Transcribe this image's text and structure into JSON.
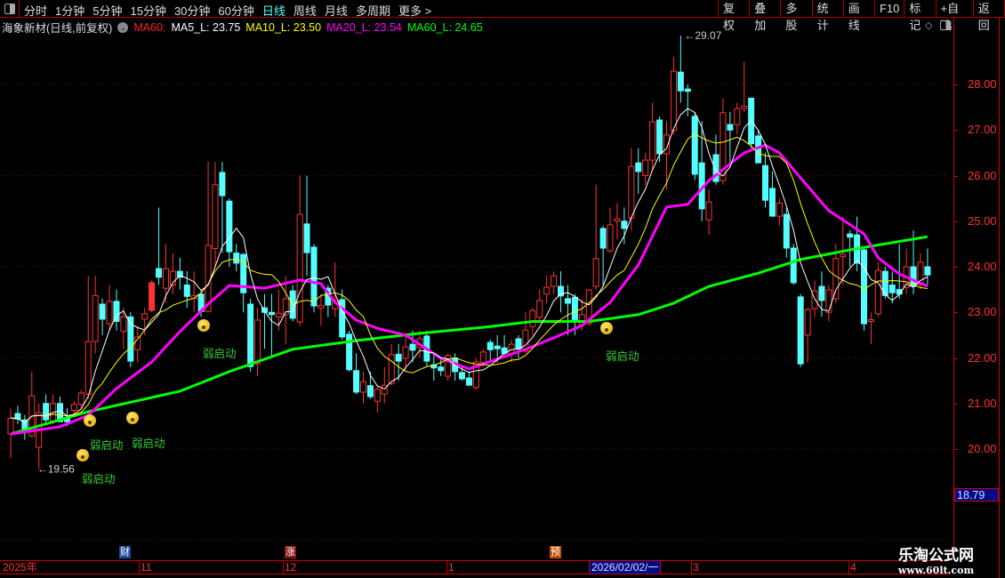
{
  "toolbar": {
    "periods": [
      "分时",
      "1分钟",
      "5分钟",
      "15分钟",
      "30分钟",
      "60分钟",
      "日线",
      "周线",
      "月线",
      "多周期",
      "更多 >"
    ],
    "active_period": "日线",
    "right_buttons": [
      "复权",
      "叠加",
      "多股",
      "统计",
      "画线",
      "F10",
      "标记",
      "+自选",
      "返回"
    ]
  },
  "title": {
    "stock": "海象新材(日线,前复权)",
    "ma_name": "MA60:",
    "ma5": "MA5_L: 23.75",
    "ma10": "MA10_L: 23.50",
    "ma20": "MA20_L: 23.54",
    "ma60": "MA60_L: 24.65"
  },
  "colors": {
    "up": "#ff3232",
    "down": "#54ffff",
    "ma5": "#ffffff",
    "ma10": "#ffff00",
    "ma20": "#ff00ff",
    "ma60": "#00ff00",
    "grid": "#a00000"
  },
  "price_axis": {
    "labels": [
      "28.00",
      "27.00",
      "26.00",
      "25.00",
      "24.00",
      "23.00",
      "22.00",
      "21.00",
      "20.00"
    ],
    "current": "18.79"
  },
  "chart_data": {
    "type": "candlestick",
    "ylim": [
      18.79,
      29.3
    ],
    "high_label": "29.07",
    "low_label": "19.56",
    "candles": [
      [
        20.33,
        20.9,
        19.8,
        20.68
      ],
      [
        20.78,
        20.95,
        20.55,
        20.66
      ],
      [
        20.64,
        20.75,
        20.2,
        20.39
      ],
      [
        20.29,
        21.7,
        20.25,
        21.17
      ],
      [
        20.04,
        21.0,
        19.56,
        20.8
      ],
      [
        21.0,
        21.2,
        20.55,
        20.64
      ],
      [
        20.62,
        21.2,
        20.55,
        21.0
      ],
      [
        21.0,
        21.15,
        20.6,
        20.6
      ],
      [
        20.68,
        20.9,
        20.5,
        20.6
      ],
      [
        20.85,
        21.05,
        20.7,
        20.98
      ],
      [
        20.98,
        21.3,
        20.9,
        21.23
      ],
      [
        21.2,
        23.8,
        21.1,
        22.36
      ],
      [
        22.36,
        23.8,
        22.1,
        23.37
      ],
      [
        23.18,
        23.3,
        22.5,
        22.85
      ],
      [
        22.75,
        23.6,
        22.6,
        23.24
      ],
      [
        23.24,
        23.5,
        22.6,
        22.8
      ],
      [
        22.58,
        23.1,
        22.2,
        22.9
      ],
      [
        22.9,
        23.0,
        21.8,
        21.93
      ],
      [
        22.18,
        22.7,
        21.9,
        22.46
      ],
      [
        22.85,
        23.1,
        22.5,
        22.97
      ],
      [
        23.04,
        23.7,
        23.0,
        23.65
      ],
      [
        23.96,
        25.3,
        23.6,
        23.77
      ],
      [
        23.53,
        24.5,
        23.2,
        23.96
      ],
      [
        23.6,
        24.3,
        23.4,
        23.9
      ],
      [
        23.9,
        24.2,
        23.5,
        23.77
      ],
      [
        23.6,
        23.9,
        23.1,
        23.35
      ],
      [
        23.3,
        23.9,
        23.0,
        23.37
      ],
      [
        23.4,
        23.5,
        22.9,
        23.02
      ],
      [
        23.02,
        26.3,
        23.0,
        24.47
      ],
      [
        24.4,
        26.3,
        24.0,
        25.8
      ],
      [
        26.07,
        26.3,
        24.3,
        25.56
      ],
      [
        25.44,
        25.5,
        24.0,
        24.33
      ],
      [
        24.3,
        24.5,
        23.9,
        24.08
      ],
      [
        24.27,
        24.3,
        23.0,
        23.43
      ],
      [
        23.18,
        23.3,
        21.7,
        21.81
      ],
      [
        21.87,
        23.1,
        21.6,
        22.83
      ],
      [
        23.1,
        23.4,
        22.2,
        23.0
      ],
      [
        23.0,
        23.4,
        22.0,
        22.95
      ],
      [
        22.9,
        23.5,
        22.6,
        22.98
      ],
      [
        22.95,
        23.8,
        22.3,
        23.3
      ],
      [
        23.47,
        23.6,
        22.8,
        22.87
      ],
      [
        22.79,
        26.0,
        22.7,
        25.15
      ],
      [
        24.94,
        26.0,
        23.8,
        24.31
      ],
      [
        24.43,
        24.5,
        23.0,
        23.14
      ],
      [
        23.1,
        23.4,
        22.7,
        23.15
      ],
      [
        23.53,
        23.6,
        22.9,
        23.16
      ],
      [
        23.08,
        24.1,
        22.9,
        23.26
      ],
      [
        23.28,
        23.5,
        22.4,
        22.46
      ],
      [
        22.52,
        22.6,
        21.7,
        21.74
      ],
      [
        21.72,
        22.1,
        21.2,
        21.25
      ],
      [
        21.25,
        21.7,
        21.0,
        21.48
      ],
      [
        21.39,
        21.7,
        21.1,
        21.15
      ],
      [
        21.05,
        21.4,
        20.8,
        21.31
      ],
      [
        21.21,
        21.8,
        21.0,
        21.4
      ],
      [
        21.44,
        22.3,
        21.4,
        22.07
      ],
      [
        22.08,
        22.3,
        21.5,
        21.93
      ],
      [
        21.99,
        22.5,
        21.7,
        22.24
      ],
      [
        22.3,
        22.6,
        21.9,
        22.17
      ],
      [
        22.22,
        22.6,
        22.0,
        22.42
      ],
      [
        22.48,
        22.6,
        21.8,
        21.93
      ],
      [
        21.85,
        22.1,
        21.5,
        21.78
      ],
      [
        21.8,
        22.0,
        21.6,
        21.72
      ],
      [
        21.6,
        22.1,
        21.5,
        22.05
      ],
      [
        22.0,
        22.1,
        21.5,
        21.7
      ],
      [
        21.68,
        21.8,
        21.5,
        21.54
      ],
      [
        21.56,
        21.7,
        21.4,
        21.4
      ],
      [
        21.35,
        22.0,
        21.3,
        21.91
      ],
      [
        21.9,
        22.2,
        21.8,
        22.13
      ],
      [
        22.34,
        22.4,
        21.9,
        22.18
      ],
      [
        22.26,
        22.5,
        21.9,
        22.2
      ],
      [
        22.22,
        22.5,
        22.0,
        22.1
      ],
      [
        22.09,
        22.4,
        21.9,
        22.3
      ],
      [
        22.42,
        22.5,
        22.0,
        22.2
      ],
      [
        22.15,
        23.0,
        22.1,
        22.61
      ],
      [
        22.69,
        23.1,
        22.5,
        23.04
      ],
      [
        22.89,
        23.5,
        22.8,
        23.26
      ],
      [
        23.4,
        23.8,
        23.2,
        23.55
      ],
      [
        23.57,
        23.9,
        23.4,
        23.8
      ],
      [
        23.57,
        23.9,
        23.0,
        23.36
      ],
      [
        23.3,
        23.6,
        22.5,
        23.2
      ],
      [
        23.33,
        23.4,
        22.5,
        22.83
      ],
      [
        22.73,
        23.3,
        22.6,
        22.95
      ],
      [
        22.75,
        23.4,
        22.7,
        23.49
      ],
      [
        23.57,
        25.8,
        23.5,
        24.18
      ],
      [
        24.84,
        24.9,
        23.6,
        24.41
      ],
      [
        24.35,
        25.3,
        24.3,
        24.92
      ],
      [
        25.0,
        25.4,
        24.6,
        25.05
      ],
      [
        25.0,
        25.3,
        24.5,
        24.84
      ],
      [
        25.07,
        26.6,
        24.8,
        26.2
      ],
      [
        26.28,
        26.6,
        25.6,
        26.09
      ],
      [
        26.0,
        26.5,
        25.8,
        26.34
      ],
      [
        26.34,
        27.6,
        26.1,
        27.18
      ],
      [
        27.22,
        27.3,
        26.3,
        26.48
      ],
      [
        26.48,
        27.2,
        25.7,
        26.89
      ],
      [
        26.99,
        28.6,
        26.9,
        28.29
      ],
      [
        28.27,
        29.07,
        27.6,
        27.86
      ],
      [
        27.9,
        28.0,
        27.3,
        27.85
      ],
      [
        27.3,
        27.4,
        25.9,
        26.03
      ],
      [
        26.28,
        27.2,
        25.0,
        25.27
      ],
      [
        25.03,
        25.7,
        24.7,
        25.42
      ],
      [
        26.46,
        26.9,
        25.8,
        25.87
      ],
      [
        25.89,
        27.7,
        25.8,
        27.38
      ],
      [
        27.12,
        27.4,
        26.2,
        27.0
      ],
      [
        27.12,
        27.6,
        26.9,
        27.47
      ],
      [
        27.47,
        28.5,
        27.4,
        27.52
      ],
      [
        27.7,
        27.7,
        26.6,
        26.7
      ],
      [
        26.87,
        27.0,
        26.4,
        26.28
      ],
      [
        26.22,
        26.5,
        25.3,
        25.46
      ],
      [
        25.72,
        26.1,
        25.1,
        25.11
      ],
      [
        25.11,
        25.5,
        24.9,
        25.4
      ],
      [
        25.15,
        25.3,
        24.2,
        24.41
      ],
      [
        24.41,
        24.5,
        23.6,
        23.65
      ],
      [
        23.34,
        23.4,
        21.8,
        21.87
      ],
      [
        22.5,
        23.1,
        21.9,
        23.06
      ],
      [
        23.08,
        23.7,
        22.9,
        23.47
      ],
      [
        23.57,
        23.9,
        22.9,
        23.26
      ],
      [
        23.0,
        23.6,
        22.8,
        23.49
      ],
      [
        23.3,
        24.5,
        23.2,
        24.18
      ],
      [
        24.22,
        25.1,
        23.6,
        24.27
      ],
      [
        24.72,
        24.8,
        24.0,
        24.65
      ],
      [
        24.7,
        25.1,
        23.9,
        24.08
      ],
      [
        24.37,
        24.4,
        22.6,
        22.75
      ],
      [
        22.8,
        23.0,
        22.3,
        22.84
      ],
      [
        22.97,
        24.1,
        22.9,
        23.92
      ],
      [
        23.9,
        24.0,
        23.3,
        23.37
      ],
      [
        23.6,
        23.9,
        23.2,
        23.43
      ],
      [
        23.5,
        24.5,
        23.3,
        23.4
      ],
      [
        23.55,
        24.4,
        23.4,
        24.0
      ],
      [
        24.0,
        24.8,
        23.4,
        23.57
      ],
      [
        23.61,
        24.3,
        23.5,
        24.1
      ],
      [
        24.0,
        24.4,
        23.6,
        23.82
      ]
    ],
    "ma20_points": [
      [
        0,
        20.33
      ],
      [
        7,
        20.49
      ],
      [
        11,
        20.74
      ],
      [
        15,
        21.33
      ],
      [
        20,
        21.91
      ],
      [
        24,
        22.58
      ],
      [
        28,
        23.18
      ],
      [
        31,
        23.59
      ],
      [
        36,
        23.53
      ],
      [
        41,
        23.71
      ],
      [
        44,
        23.63
      ],
      [
        46,
        23.22
      ],
      [
        49,
        22.83
      ],
      [
        52,
        22.65
      ],
      [
        56,
        22.5
      ],
      [
        61,
        21.99
      ],
      [
        65,
        21.76
      ],
      [
        73,
        22.19
      ],
      [
        77,
        22.44
      ],
      [
        81,
        22.71
      ],
      [
        85,
        23.22
      ],
      [
        89,
        24.04
      ],
      [
        93,
        25.31
      ],
      [
        96,
        25.37
      ],
      [
        99,
        25.89
      ],
      [
        104,
        26.5
      ],
      [
        107,
        26.67
      ],
      [
        109,
        26.5
      ],
      [
        112,
        25.95
      ],
      [
        116,
        25.23
      ],
      [
        118,
        25.03
      ],
      [
        121,
        24.72
      ],
      [
        123,
        24.2
      ],
      [
        126,
        23.84
      ],
      [
        130,
        23.57
      ]
    ],
    "ma60_points": [
      [
        0,
        20.33
      ],
      [
        11,
        20.82
      ],
      [
        24,
        21.27
      ],
      [
        31,
        21.7
      ],
      [
        40,
        22.19
      ],
      [
        49,
        22.38
      ],
      [
        58,
        22.54
      ],
      [
        67,
        22.67
      ],
      [
        74,
        22.8
      ],
      [
        82,
        22.8
      ],
      [
        89,
        22.95
      ],
      [
        94,
        23.2
      ],
      [
        99,
        23.57
      ],
      [
        106,
        23.86
      ],
      [
        112,
        24.16
      ],
      [
        120,
        24.4
      ],
      [
        130,
        24.66
      ]
    ]
  },
  "signals": {
    "label": "弱启动",
    "candle_indices": [
      11,
      17,
      11,
      27,
      84
    ]
  },
  "events": [
    {
      "text": "财",
      "color": "#1a4a9a"
    },
    {
      "text": "涨",
      "color": "#8a1010"
    },
    {
      "text": "预",
      "color": "#c05000"
    }
  ],
  "date_axis": {
    "labels": [
      "2025年",
      "11",
      "12",
      "1",
      "2026/02/02/一",
      "3",
      "4"
    ],
    "selected": "2026/02/02/一"
  },
  "watermark": {
    "name": "乐淘公式网",
    "url": "www.60lt.com"
  }
}
